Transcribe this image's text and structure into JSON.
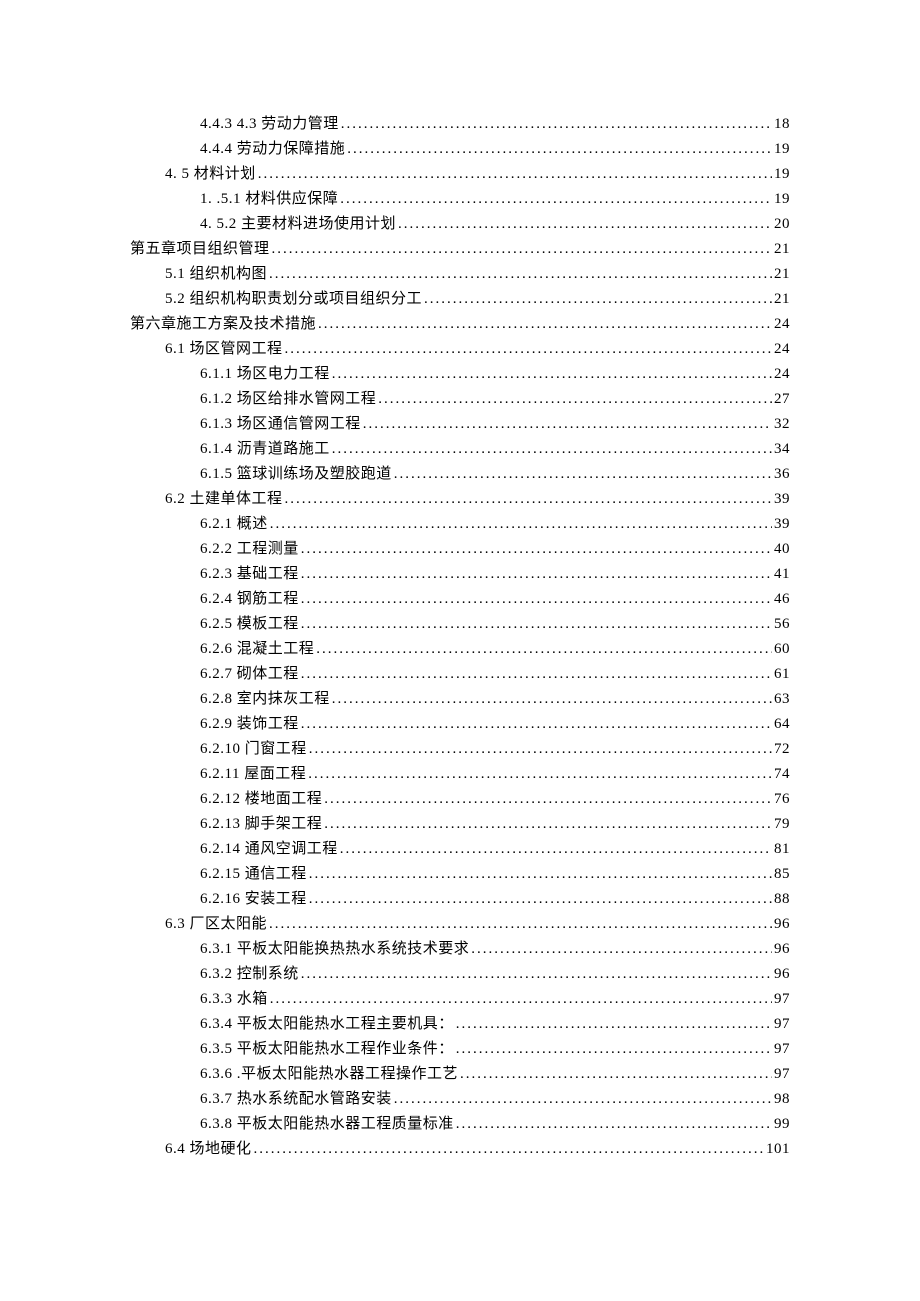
{
  "toc": [
    {
      "indent": 2,
      "label": "4.4.3  4.3 劳动力管理",
      "page": "18"
    },
    {
      "indent": 2,
      "label": "4.4.4  劳动力保障措施",
      "page": "19"
    },
    {
      "indent": 1,
      "label": "4.  5 材料计划 ",
      "page": "19"
    },
    {
      "indent": 2,
      "label": "1.  .5.1 材料供应保障",
      "page": "19"
    },
    {
      "indent": 2,
      "label": "4.  5.2 主要材料进场使用计划",
      "page": "20"
    },
    {
      "indent": 0,
      "label": "第五章项目组织管理 ",
      "page": "21"
    },
    {
      "indent": 1,
      "label": "5.1   组织机构图 ",
      "page": "21"
    },
    {
      "indent": 1,
      "label": "5.2   组织机构职责划分或项目组织分工 ",
      "page": "21"
    },
    {
      "indent": 0,
      "label": "第六章施工方案及技术措施 ",
      "page": "24"
    },
    {
      "indent": 1,
      "label": "6.1 场区管网工程 ",
      "page": "24"
    },
    {
      "indent": 2,
      "label": "6.1.1 场区电力工程 ",
      "page": "24"
    },
    {
      "indent": 2,
      "label": "6.1.2 场区给排水管网工程 ",
      "page": "27"
    },
    {
      "indent": 2,
      "label": "6.1.3 场区通信管网工程 ",
      "page": "32"
    },
    {
      "indent": 2,
      "label": "6.1.4 沥青道路施工 ",
      "page": "34"
    },
    {
      "indent": 2,
      "label": "6.1.5 篮球训练场及塑胶跑道 ",
      "page": "36"
    },
    {
      "indent": 1,
      "label": "6.2 土建单体工程 ",
      "page": "39"
    },
    {
      "indent": 2,
      "label": "6.2.1 概述 ",
      "page": "39"
    },
    {
      "indent": 2,
      "label": "6.2.2 工程测量 ",
      "page": "40"
    },
    {
      "indent": 2,
      "label": "6.2.3 基础工程 ",
      "page": "41"
    },
    {
      "indent": 2,
      "label": "6.2.4 钢筋工程 ",
      "page": "46"
    },
    {
      "indent": 2,
      "label": "6.2.5 模板工程 ",
      "page": "56"
    },
    {
      "indent": 2,
      "label": "6.2.6 混凝土工程 ",
      "page": "60"
    },
    {
      "indent": 2,
      "label": "6.2.7 砌体工程 ",
      "page": "61"
    },
    {
      "indent": 2,
      "label": "6.2.8 室内抹灰工程 ",
      "page": "63"
    },
    {
      "indent": 2,
      "label": "6.2.9 装饰工程 ",
      "page": "64"
    },
    {
      "indent": 2,
      "label": "6.2.10 门窗工程 ",
      "page": "72"
    },
    {
      "indent": 2,
      "label": "6.2.11 屋面工程 ",
      "page": "74"
    },
    {
      "indent": 2,
      "label": "6.2.12 楼地面工程 ",
      "page": "76"
    },
    {
      "indent": 2,
      "label": "6.2.13 脚手架工程 ",
      "page": "79"
    },
    {
      "indent": 2,
      "label": "6.2.14 通风空调工程 ",
      "page": "81"
    },
    {
      "indent": 2,
      "label": "6.2.15 通信工程 ",
      "page": "85"
    },
    {
      "indent": 2,
      "label": "6.2.16 安装工程 ",
      "page": "88"
    },
    {
      "indent": 1,
      "label": "6.3 厂区太阳能 ",
      "page": "96"
    },
    {
      "indent": 2,
      "label": "6.3.1 平板太阳能换热热水系统技术要求 ",
      "page": "96"
    },
    {
      "indent": 2,
      "label": "6.3.2 控制系统 ",
      "page": "96"
    },
    {
      "indent": 2,
      "label": "6.3.3 水箱 ",
      "page": "97"
    },
    {
      "indent": 2,
      "label": "6.3.4  平板太阳能热水工程主要机具：  ",
      "page": "97"
    },
    {
      "indent": 2,
      "label": "6.3.5  平板太阳能热水工程作业条件：  ",
      "page": "97"
    },
    {
      "indent": 2,
      "label": "6.3.6  .平板太阳能热水器工程操作工艺 ",
      "page": "97"
    },
    {
      "indent": 2,
      "label": "6.3.7  热水系统配水管路安装 ",
      "page": "98"
    },
    {
      "indent": 2,
      "label": "6.3.8  平板太阳能热水器工程质量标准 ",
      "page": "99"
    },
    {
      "indent": 1,
      "label": "6.4 场地硬化 ",
      "page": "101"
    }
  ]
}
